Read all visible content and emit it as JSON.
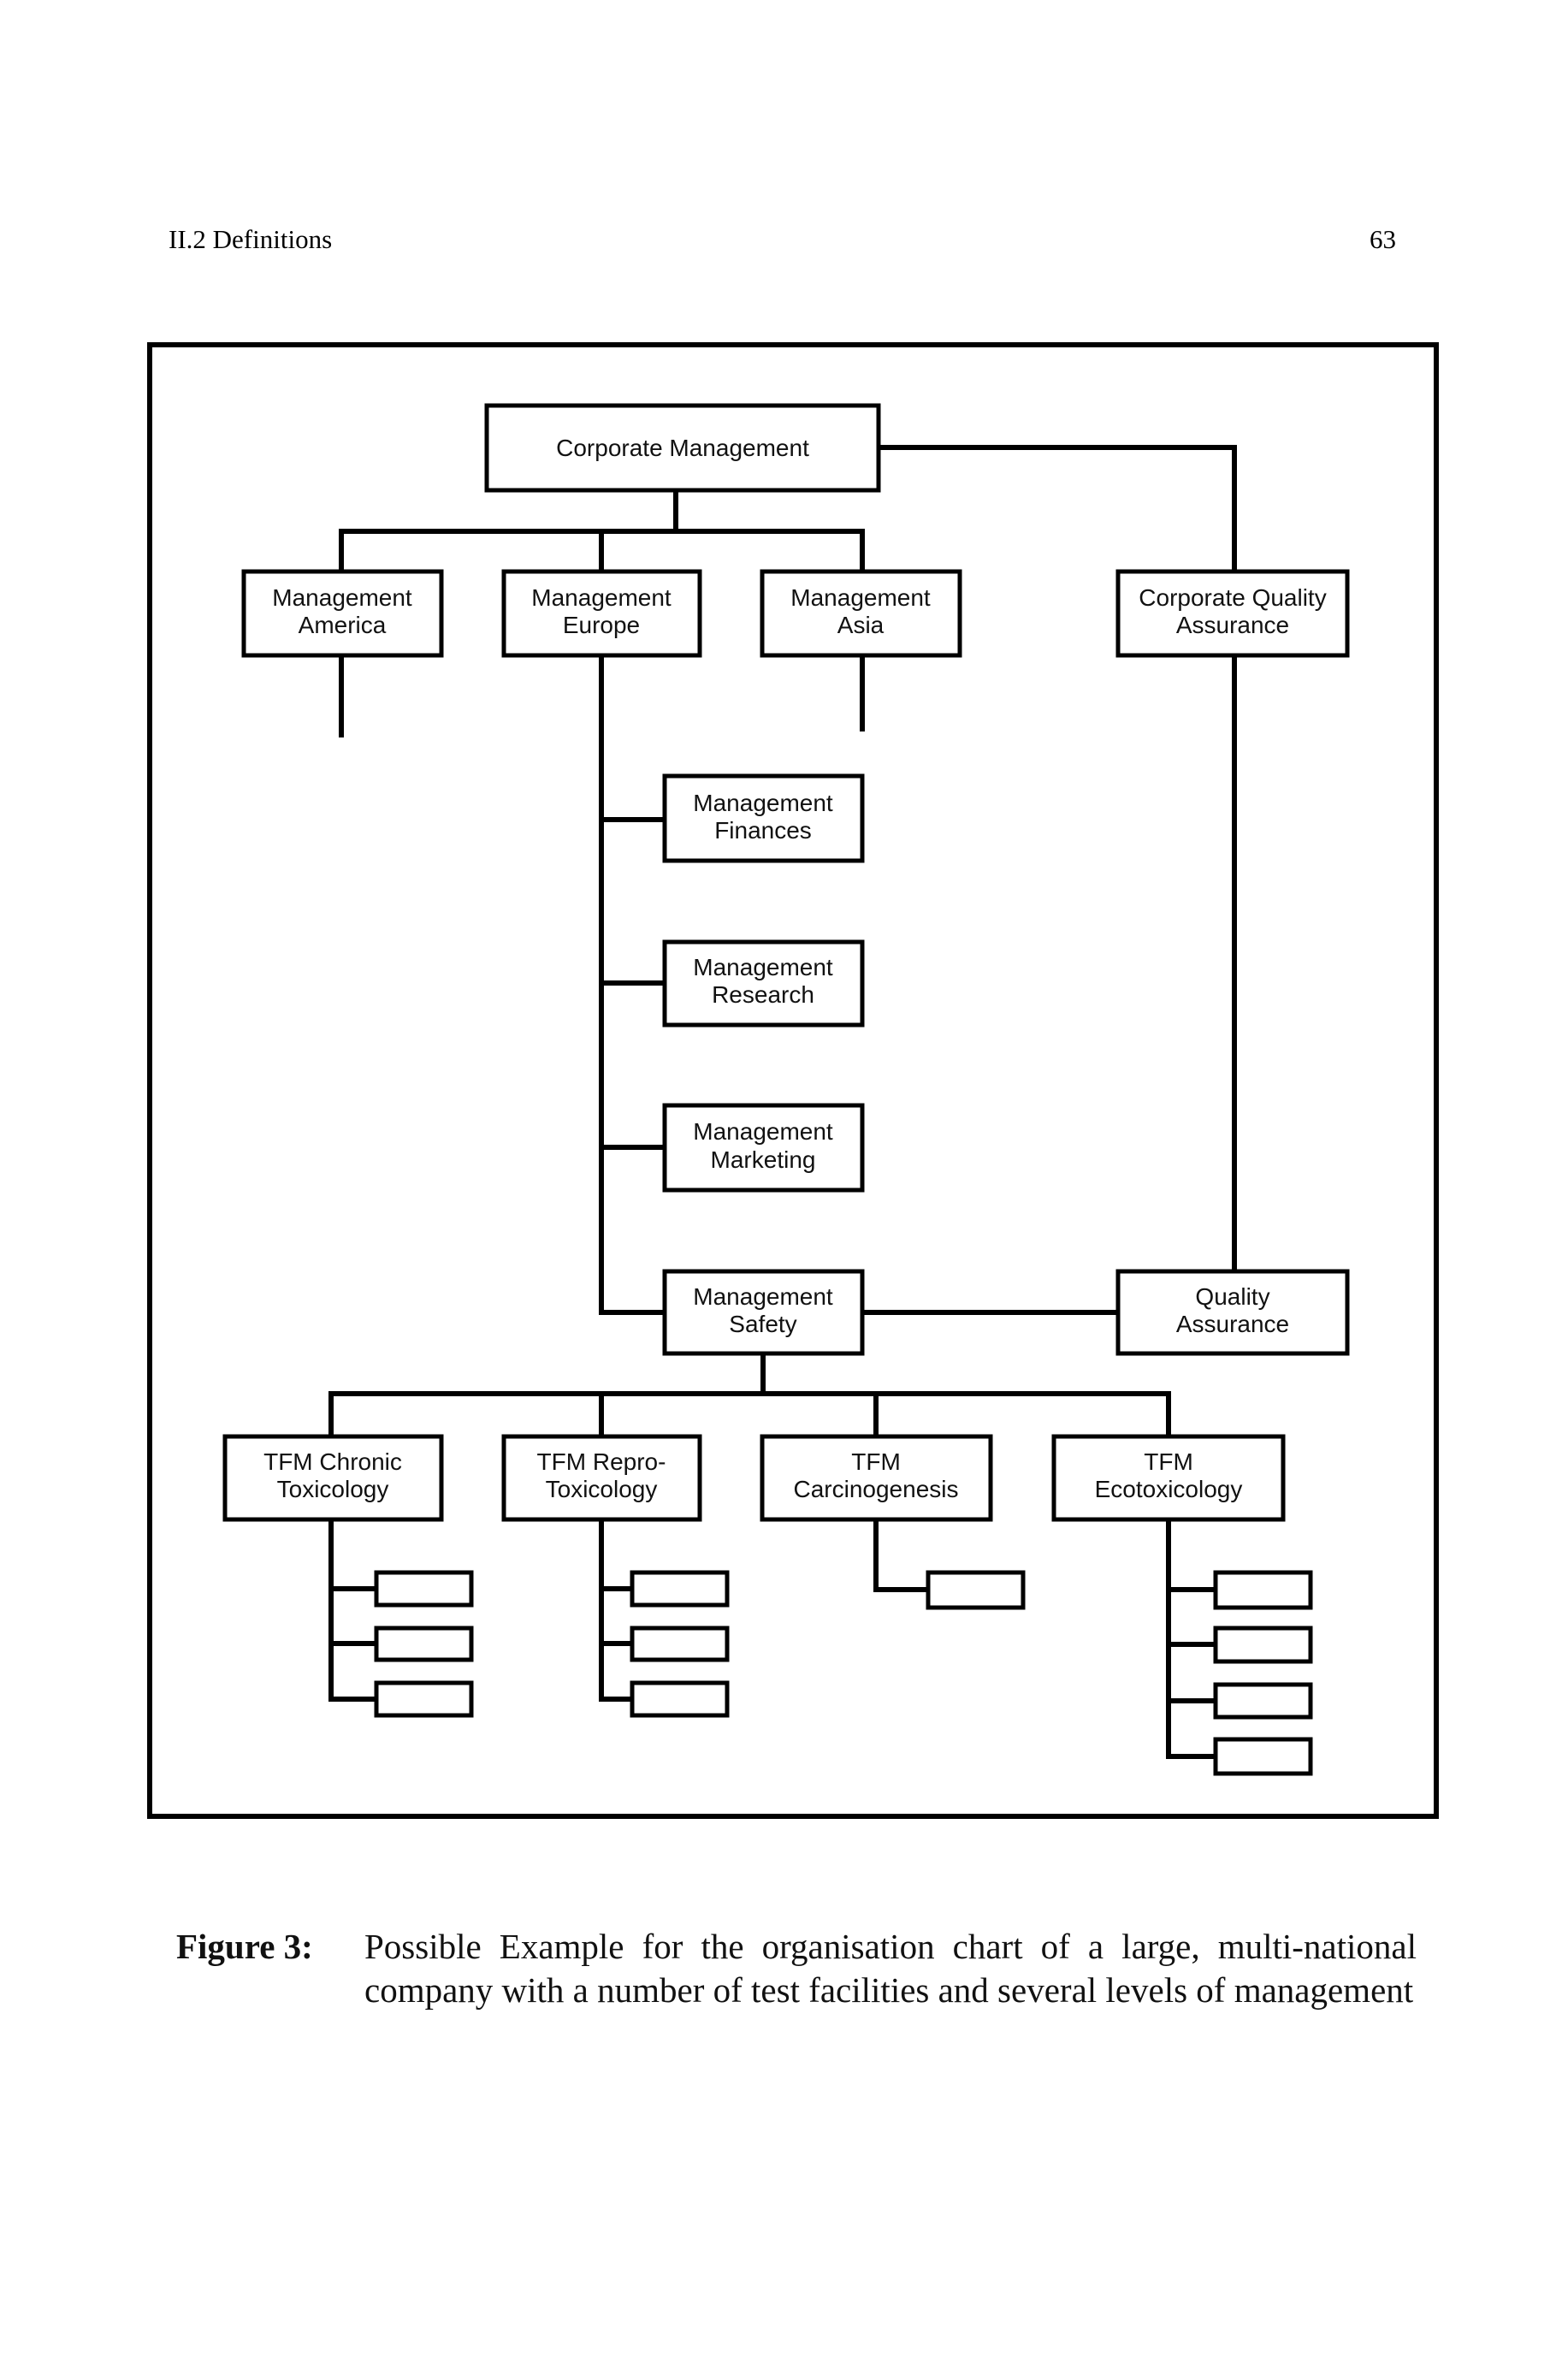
{
  "header": {
    "running_head": "II.2  Definitions",
    "page_number": "63"
  },
  "chart": {
    "nodes": {
      "corporate_management": [
        "Corporate Management"
      ],
      "management_america": [
        "Management",
        "America"
      ],
      "management_europe": [
        "Management",
        "Europe"
      ],
      "management_asia": [
        "Management",
        "Asia"
      ],
      "corporate_quality_assurance": [
        "Corporate Quality",
        "Assurance"
      ],
      "management_finances": [
        "Management",
        "Finances"
      ],
      "management_research": [
        "Management",
        "Research"
      ],
      "management_marketing": [
        "Management",
        "Marketing"
      ],
      "management_safety": [
        "Management",
        "Safety"
      ],
      "quality_assurance": [
        "Quality",
        "Assurance"
      ],
      "tfm_chronic": [
        "TFM Chronic",
        "Toxicology"
      ],
      "tfm_repro": [
        "TFM Repro-",
        "Toxicology"
      ],
      "tfm_carcinogenesis": [
        "TFM",
        "Carcinogenesis"
      ],
      "tfm_ecotoxicology": [
        "TFM",
        "Ecotoxicology"
      ]
    },
    "unlabeled_subunits": {
      "tfm_chronic": 3,
      "tfm_repro": 3,
      "tfm_carcinogenesis": 1,
      "tfm_ecotoxicology": 4
    },
    "relations": [
      [
        "corporate_management",
        "management_america"
      ],
      [
        "corporate_management",
        "management_europe"
      ],
      [
        "corporate_management",
        "management_asia"
      ],
      [
        "corporate_management",
        "corporate_quality_assurance"
      ],
      [
        "management_europe",
        "management_finances"
      ],
      [
        "management_europe",
        "management_research"
      ],
      [
        "management_europe",
        "management_marketing"
      ],
      [
        "management_europe",
        "management_safety"
      ],
      [
        "corporate_quality_assurance",
        "quality_assurance"
      ],
      [
        "management_safety",
        "quality_assurance"
      ],
      [
        "management_safety",
        "tfm_chronic"
      ],
      [
        "management_safety",
        "tfm_repro"
      ],
      [
        "management_safety",
        "tfm_carcinogenesis"
      ],
      [
        "management_safety",
        "tfm_ecotoxicology"
      ]
    ]
  },
  "caption": {
    "label": "Figure 3:",
    "text": "Possible Example for the organisation chart of a large, multi-national company with a number of test facilities and several levels of management"
  }
}
